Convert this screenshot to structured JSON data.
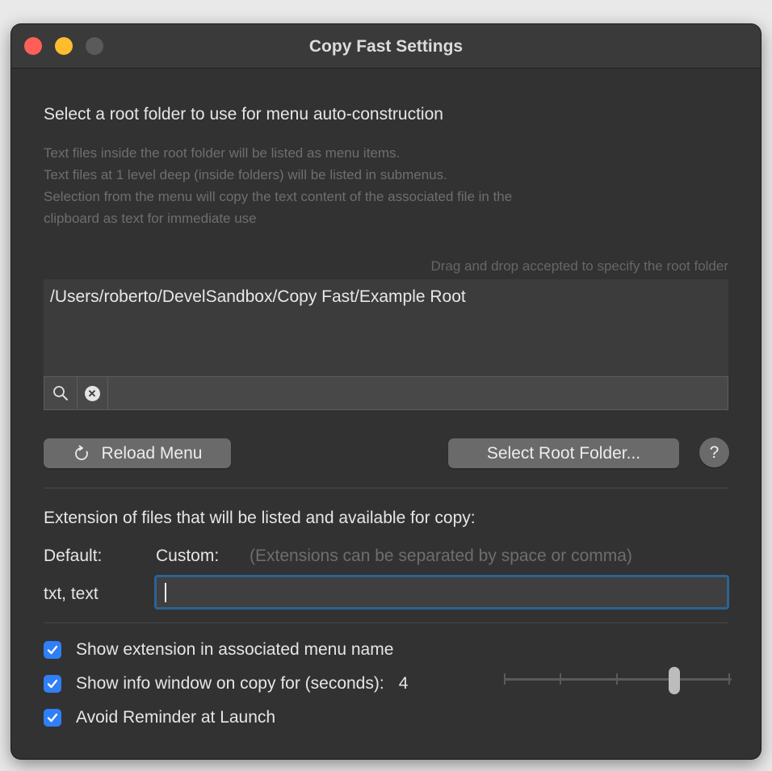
{
  "window": {
    "title": "Copy Fast Settings"
  },
  "root": {
    "heading": "Select a root folder to use for menu auto-construction",
    "description": [
      "Text files inside the root folder will be listed as menu items.",
      "Text files at 1 level deep (inside folders) will be listed in submenus.",
      "Selection from the menu will copy the text content of the associated file in the",
      "clipboard as text for immediate use"
    ],
    "drag_hint": "Drag and drop accepted to specify the root folder",
    "path": "/Users/roberto/DevelSandbox/Copy Fast/Example Root",
    "search_value": ""
  },
  "buttons": {
    "reload": "Reload Menu",
    "select_root": "Select Root Folder...",
    "help": "?"
  },
  "extensions": {
    "heading": "Extension of files that will be listed and available for copy:",
    "default_label": "Default:",
    "custom_label": "Custom:",
    "custom_hint": "(Extensions can be separated by space or comma)",
    "default_value": "txt, text",
    "custom_value": ""
  },
  "options": {
    "show_extension": {
      "label": "Show extension in associated menu name",
      "checked": true
    },
    "show_info": {
      "label": "Show info window on copy for (seconds):",
      "checked": true,
      "value": "4"
    },
    "avoid_reminder": {
      "label": "Avoid Reminder at Launch",
      "checked": true
    }
  },
  "slider": {
    "min": 1,
    "max": 5,
    "value": 4,
    "ticks": 5
  },
  "colors": {
    "window_bg": "#323232",
    "accent": "#2f7ff6",
    "focus_ring": "#2c6394",
    "traffic_close": "#ff5f57",
    "traffic_min": "#febc2e"
  },
  "icons": {
    "reload": "reload-icon",
    "search": "search-icon",
    "clear": "clear-icon",
    "check": "checkmark-icon"
  }
}
